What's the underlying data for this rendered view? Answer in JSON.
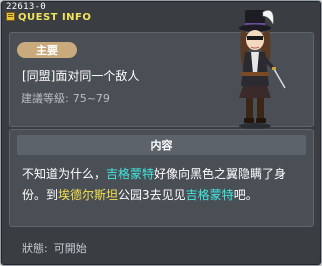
{
  "window": {
    "quest_id": "22613-0",
    "title": "QUEST INFO"
  },
  "summary": {
    "type_badge": "主要",
    "quest_name": "[同盟]面对同一个敌人",
    "level_label": "建議等級:",
    "level_range": "75~79"
  },
  "content": {
    "header": "内容",
    "line1_prefix": "不知道为什么，",
    "npc_name": "吉格蒙特",
    "line1_suffix": "好像向黑色之翼隐瞒了身",
    "line2_prefix": "份。到",
    "location_name": "埃德尔斯坦",
    "line2_middle": "公园3去见见",
    "npc_name_2": "吉格蒙特",
    "line2_suffix": "吧。"
  },
  "status": {
    "label": "狀態:",
    "value": "可開始"
  },
  "colors": {
    "title": "#f2e45a",
    "npc_highlight": "#3fe8e0",
    "location_highlight": "#f5e24a",
    "badge": "#c8aa7c"
  },
  "icons": {
    "title_icon": "quest-book-icon",
    "npc": "npc-portrait"
  }
}
